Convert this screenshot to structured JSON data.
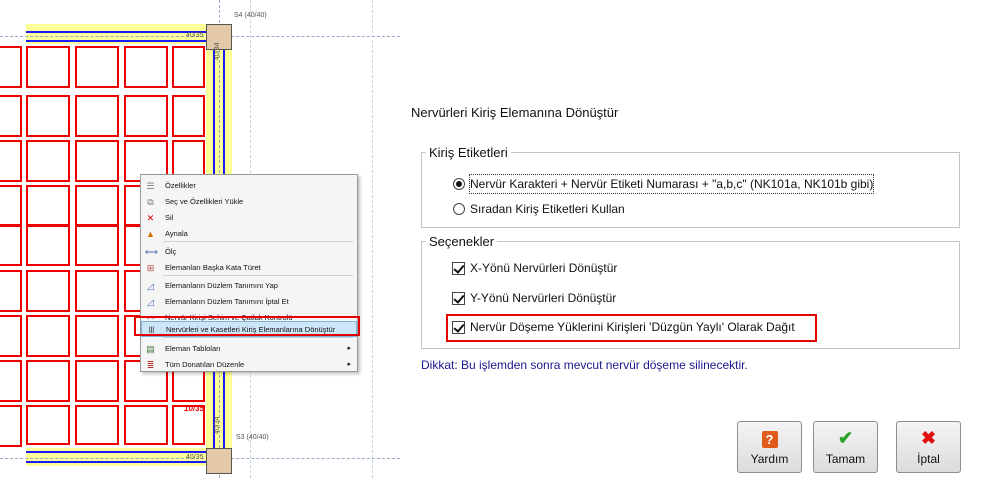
{
  "cad": {
    "labels": {
      "top_column": "S4 (40/40)",
      "bottom_column": "S3 (40/40)",
      "beam_top_left": "40/35",
      "beam_bottom_left": "40/35",
      "beam_red": "10/35",
      "beam_vertical": "40/34",
      "beam_vertical_bottom": "40/34"
    },
    "colors": {
      "rib": "#ee0000",
      "slab": "#ffff99",
      "beam_line": "#1a1aff"
    }
  },
  "context_menu": {
    "items": [
      {
        "label": "Özellikler",
        "icon": "properties-icon"
      },
      {
        "label": "Seç ve Özellikleri Yükle",
        "icon": "select-load-icon"
      },
      {
        "label": "Sil",
        "icon": "delete-icon"
      },
      {
        "label": "Aynala",
        "icon": "mirror-icon"
      },
      {
        "label": "Ölç",
        "icon": "measure-icon"
      },
      {
        "label": "Elemanları Başka Kata Türet",
        "icon": "copy-floor-icon"
      },
      {
        "label": "Elemanların Düzlem Tanımını Yap",
        "icon": "plane-define-icon"
      },
      {
        "label": "Elemanların Düzlem Tanımını İptal Et",
        "icon": "plane-cancel-icon"
      },
      {
        "label": "Nervür Kirişi Sehim ve Çatlak Kontrolü",
        "icon": "deflection-icon"
      },
      {
        "label": "Nervürleri ve Kasetleri Kiriş Elemanlarına Dönüştür",
        "icon": "convert-rib-icon"
      },
      {
        "label": "Eleman Tabloları",
        "icon": "table-icon"
      },
      {
        "label": "Tüm Donatıları Düzenle",
        "icon": "rebar-icon"
      }
    ],
    "highlighted_index": 9
  },
  "dialog": {
    "title": "Nervürleri Kiriş Elemanına Dönüştür",
    "group_labels": {
      "title": "Kiriş Etiketleri",
      "options": [
        {
          "label": "Nervür Karakteri + Nervür Etiketi Numarası + \"a,b,c\" (NK101a, NK101b gibi)",
          "selected": true
        },
        {
          "label": "Sıradan Kiriş Etiketleri Kullan",
          "selected": false
        }
      ]
    },
    "group_options": {
      "title": "Seçenekler",
      "options": [
        {
          "label": "X-Yönü Nervürleri Dönüştür",
          "checked": true
        },
        {
          "label": "Y-Yönü Nervürleri Dönüştür",
          "checked": true
        },
        {
          "label": "Nervür Döşeme Yüklerini Kirişleri 'Düzgün Yaylı' Olarak Dağıt",
          "checked": true
        }
      ]
    },
    "warning": "Dikkat: Bu işlemden sonra mevcut nervür döşeme silinecektir.",
    "buttons": {
      "help": {
        "label": "Yardım",
        "icon": "help-icon",
        "glyph": "?"
      },
      "ok": {
        "label": "Tamam",
        "icon": "checkmark-icon",
        "glyph": "✔"
      },
      "cancel": {
        "label": "İptal",
        "icon": "close-icon",
        "glyph": "✖"
      }
    }
  }
}
